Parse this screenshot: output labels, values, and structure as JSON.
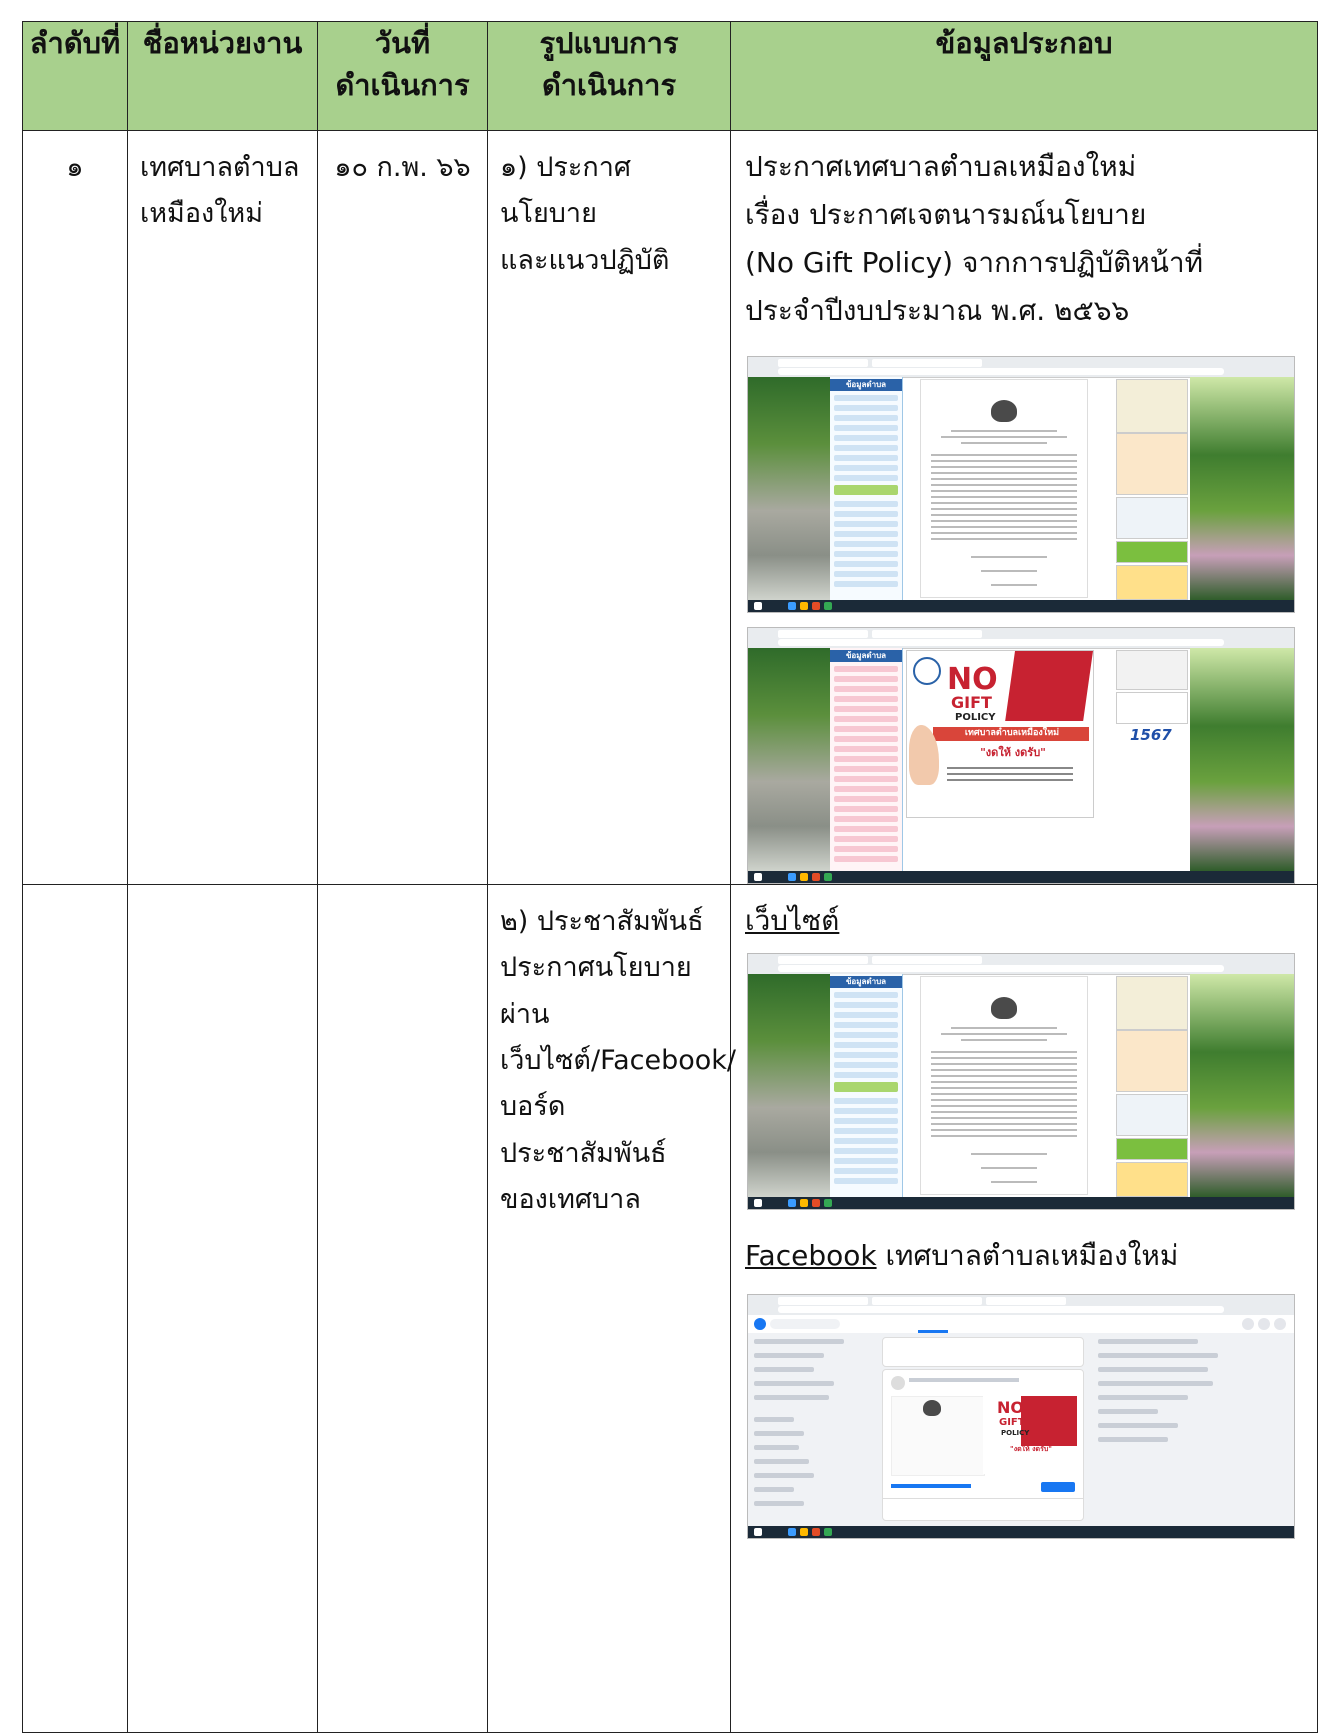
{
  "table": {
    "headers": {
      "order": "ลำดับที่",
      "agency": "ชื่อหน่วยงาน",
      "date": [
        "วันที่",
        "ดำเนินการ"
      ],
      "format": [
        "รูปแบบการ",
        "ดำเนินการ"
      ],
      "info": "ข้อมูลประกอบ"
    },
    "row1": {
      "order": "๑",
      "agency": [
        "เทศบาลตำบล",
        "เหมืองใหม่"
      ],
      "date": "๑๐ ก.พ. ๖๖",
      "format": [
        "๑) ประกาศนโยบาย",
        "และแนวปฏิบัติ"
      ],
      "info": [
        "ประกาศเทศบาลตำบลเหมืองใหม่",
        "เรื่อง  ประกาศเจตนารมณ์นโยบาย",
        "(No Gift Policy)  จากการปฏิบัติหน้าที่",
        "ประจำปีงบประมาณ พ.ศ. ๒๕๖๖"
      ]
    },
    "row2": {
      "format": [
        "๒) ประชาสัมพันธ์",
        "ประกาศนโยบายผ่าน",
        "เว็บไซต์/Facebook/",
        "บอร์ดประชาสัมพันธ์",
        "ของเทศบาล"
      ],
      "website_label": "เว็บไซต์",
      "facebook_label": "Facebook",
      "facebook_rest": " เทศบาลตำบลเหมืองใหม่"
    }
  },
  "screenshots": {
    "nogift_big": "NO",
    "nogift_gift": "GIFT",
    "nogift_policy": "POLICY",
    "nogift_banner": "เทศบาลตำบลเหมืองใหม่",
    "nogift_slogan": "\"งดให้ งดรับ\"",
    "hotline": "1567",
    "menu_header": "ข้อมูลตำบล"
  },
  "colors": {
    "header_bg": "#a8d08d",
    "border": "#222222",
    "nogift_red": "#c72231"
  }
}
